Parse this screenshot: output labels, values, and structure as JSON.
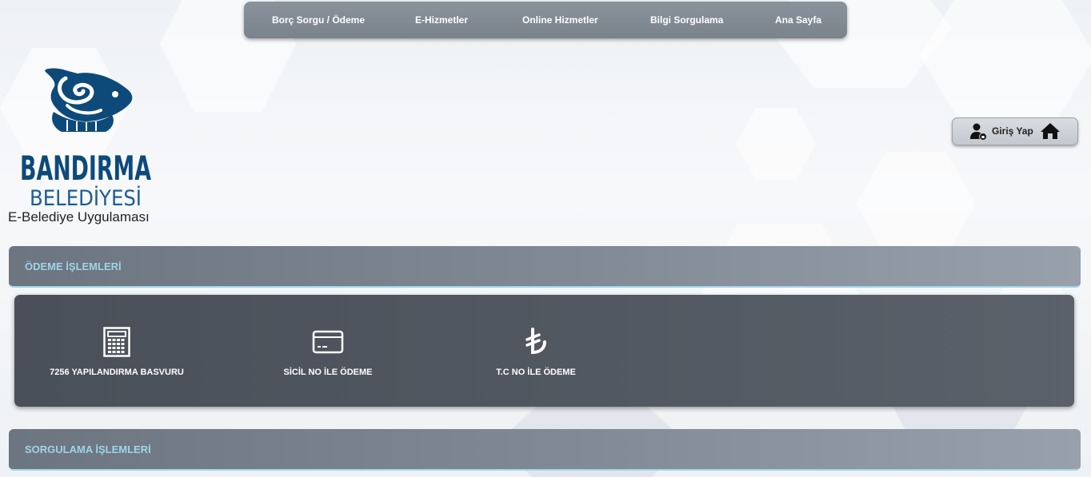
{
  "topnav": {
    "items": [
      {
        "label": "Borç Sorgu / Ödeme"
      },
      {
        "label": "E-Hizmetler"
      },
      {
        "label": "Online Hizmetler"
      },
      {
        "label": "Bilgi Sorgulama"
      },
      {
        "label": "Ana Sayfa"
      }
    ]
  },
  "brand": {
    "name": "BANDIRMA",
    "subtitle": "BELEDİYESİ",
    "app_title": "E-Belediye Uygulaması",
    "color": "#0d4a7a"
  },
  "login": {
    "label": "Giriş Yap",
    "user_icon": "user-icon",
    "home_icon": "home-icon"
  },
  "sections": {
    "payment": {
      "title": "ÖDEME İŞLEMLERİ",
      "items": [
        {
          "label": "7256 YAPILANDIRMA BASVURU",
          "icon": "calculator-icon"
        },
        {
          "label": "SİCİL NO İLE ÖDEME",
          "icon": "credit-card-icon"
        },
        {
          "label": "T.C NO İLE ÖDEME",
          "icon": "lira-icon"
        }
      ]
    },
    "query": {
      "title": "SORGULAMA İŞLEMLERİ"
    }
  },
  "colors": {
    "section_title": "#9fd3ea",
    "nav_bg": "#7a838c",
    "panel_bg": "#4e545d"
  }
}
